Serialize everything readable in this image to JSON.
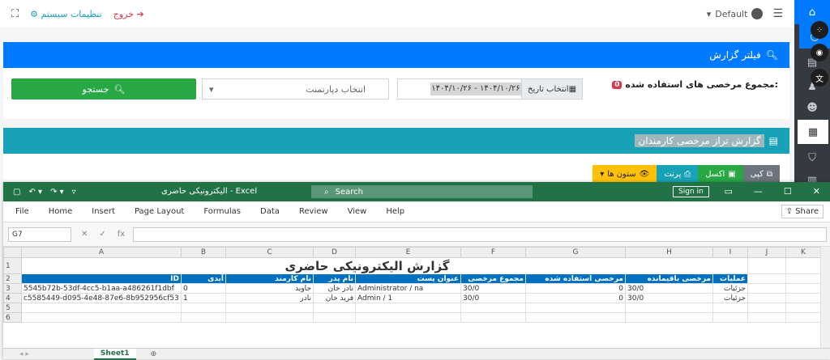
{
  "topbar": {
    "expand_icon": "⛶",
    "settings": "تنظیمات سیستم",
    "exit": "خروج",
    "user": "Default",
    "menu_icon": "☰"
  },
  "card1": {
    "title": "فیلتر گزارش",
    "total_label": "مجموع مرخصی های استفاده شده:",
    "total_value": "0",
    "date_btn": "انتخاب تاریخ",
    "date_range": "۱۴۰۴/۱۰/۲۶ - ۱۴۰۴/۱۰/۲۶",
    "dept_placeholder": "انتخاب دپارتمنت",
    "search": "جستجو"
  },
  "card2": {
    "title": "گزارش تراز مرخصی کارمندان",
    "buttons": {
      "columns": "ستون ها",
      "print": "پرنت",
      "excel": "اکسل",
      "copy": "کپی"
    }
  },
  "excel": {
    "filename": "الیکترونیکی حاضری - Excel",
    "search": "Search",
    "signin": "Sign in",
    "menu": [
      "File",
      "Home",
      "Insert",
      "Page Layout",
      "Formulas",
      "Data",
      "Review",
      "View",
      "Help"
    ],
    "share": "Share",
    "namebox": "G7",
    "columns": [
      "A",
      "B",
      "C",
      "D",
      "E",
      "F",
      "G",
      "H",
      "I",
      "J",
      "K"
    ],
    "sheet_title": "گزارش الیکترونیکی حاضری",
    "headers": [
      "ID",
      "آیدی",
      "نام کارمند",
      "نام پدر",
      "عنوان پست",
      "مجموع مرخصی",
      "مرخصی استفاده شده",
      "مرخصی باقیمانده",
      "عملیات"
    ],
    "rows": [
      [
        "5545b72b-53df-4cc5-b1aa-a486261f1dbf",
        "0",
        "جاوید",
        "نادر خان",
        "Administrator / na",
        "30/0",
        "0",
        "30/0",
        "جزئیات"
      ],
      [
        "c5585449-d095-4e48-87e6-8b952956cf53",
        "1",
        "نادر",
        "فرید خان",
        "Admin / 1",
        "30/0",
        "0",
        "30/0",
        "جزئیات"
      ]
    ],
    "sheet_tab": "Sheet1"
  }
}
